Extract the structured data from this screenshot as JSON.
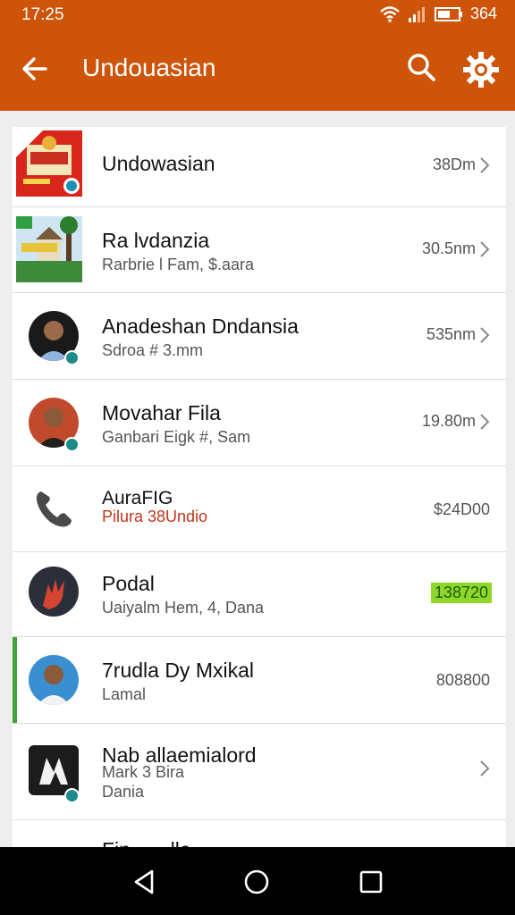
{
  "status": {
    "time": "17:25",
    "battery": "364"
  },
  "appbar": {
    "title": "Undouasian"
  },
  "colors": {
    "primary": "#cd5409",
    "accent": "#43a33a",
    "badge": "#1f8a8a",
    "highlight": "#8fd82a"
  },
  "items": [
    {
      "name": "Undowasian",
      "sub": "",
      "meta": "38Dm",
      "icon": "poster-thumbnail",
      "chevron": true
    },
    {
      "name": "Ra lvdanzia",
      "sub": "Rarbrie l Fam, $.aara",
      "meta": "30.5nm",
      "icon": "temple-thumbnail",
      "chevron": true
    },
    {
      "name": "Anadeshan Dndansia",
      "sub": "Sdroa # 3.mm",
      "meta": "535nm",
      "icon": "person-avatar",
      "chevron": true
    },
    {
      "name": "Movahar Fila",
      "sub": "Ganbari Eigk #, Sam",
      "meta": "19.80m",
      "icon": "person-avatar",
      "chevron": true
    },
    {
      "name": "AuraFIG",
      "sub": "Pilura 38Undio",
      "meta": "$24D00",
      "icon": "phone-icon",
      "chevron": false
    },
    {
      "name": "Podal",
      "sub": "Uaiyalm Hem, 4, Dana",
      "meta": "138720",
      "icon": "hand-avatar",
      "chevron": false
    },
    {
      "name": "7rudla Dy Mxikal",
      "sub": "Lamal",
      "meta": "808800",
      "icon": "person-avatar",
      "chevron": false
    },
    {
      "name": "Nab allaemialord",
      "sub": "Mark 3 Bira",
      "sub2": "Dania",
      "meta": "",
      "icon": "app-logo",
      "chevron": true
    },
    {
      "name": "Fin... ...lla",
      "sub": "",
      "meta": "",
      "icon": "",
      "chevron": false
    }
  ]
}
